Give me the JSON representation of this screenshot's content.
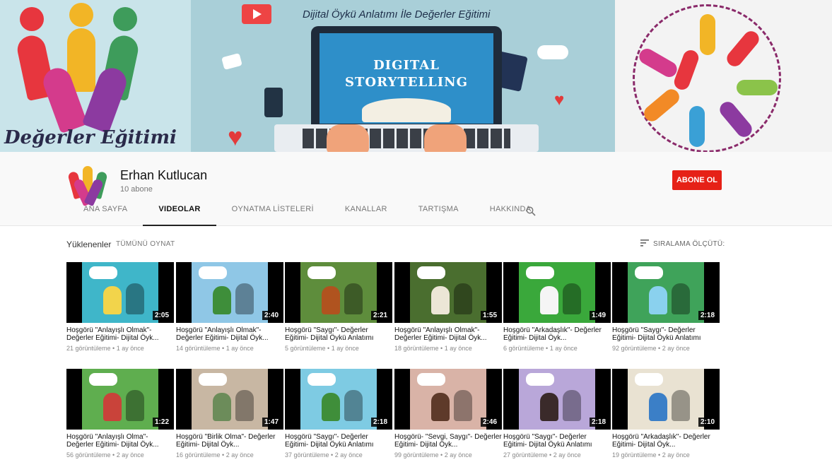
{
  "banner": {
    "title": "Dijital Öykü Anlatımı İle Değerler Eğitimi",
    "screen_line1": "DIGITAL",
    "screen_line2": "STORYTELLING",
    "left_word": "Değerler Eğitimi"
  },
  "channel": {
    "name": "Erhan Kutlucan",
    "subscribers": "10 abone",
    "subscribe_label": "ABONE OL"
  },
  "tabs": [
    "ANA SAYFA",
    "VIDEOLAR",
    "OYNATMA LİSTELERİ",
    "KANALLAR",
    "TARTIŞMA",
    "HAKKINDA"
  ],
  "uploads": {
    "title": "Yüklenenler",
    "play_all": "TÜMÜNÜ OYNAT",
    "sort_label": "SIRALAMA ÖLÇÜTÜ:"
  },
  "videos": [
    {
      "title": "Hoşgörü \"Anlayışlı Olmak\"- Değerler Eğitimi- Dijital Öyk...",
      "meta": "21 görüntüleme • 1 ay önce",
      "duration": "2:05",
      "bg": "#3fb6c9",
      "fg": "#f2d44b"
    },
    {
      "title": "Hoşgörü \"Anlayışlı Olmak\"- Değerler Eğitimi- Dijital Öyk...",
      "meta": "14 görüntüleme • 1 ay önce",
      "duration": "2:40",
      "bg": "#8fc7e6",
      "fg": "#3e8e3a"
    },
    {
      "title": "Hoşgörü \"Saygı\"- Değerler Eğitimi- Dijital Öykü Anlatımı",
      "meta": "5 görüntüleme • 1 ay önce",
      "duration": "2:21",
      "bg": "#5e8d3c",
      "fg": "#b0531f"
    },
    {
      "title": "Hoşgörü \"Anlayışlı Olmak\"- Değerler Eğitimi- Dijital Öyk...",
      "meta": "18 görüntüleme • 1 ay önce",
      "duration": "1:55",
      "bg": "#4a6e2f",
      "fg": "#ece6d6"
    },
    {
      "title": "Hoşgörü \"Arkadaşlık\"- Değerler Eğitimi- Dijital Öyk...",
      "meta": "6 görüntüleme • 1 ay önce",
      "duration": "1:49",
      "bg": "#3aa83b",
      "fg": "#f5f5f5"
    },
    {
      "title": "Hoşgörü \"Saygı\"- Değerler Eğitimi- Dijital Öykü Anlatımı",
      "meta": "92 görüntüleme • 2 ay önce",
      "duration": "2:18",
      "bg": "#3fa35a",
      "fg": "#8ad1ee"
    },
    {
      "title": "Hoşgörü \"Anlayışlı Olma\"- Değerler Eğitimi- Dijital Öyk...",
      "meta": "56 görüntüleme • 2 ay önce",
      "duration": "1:22",
      "bg": "#5fae4f",
      "fg": "#c9433a"
    },
    {
      "title": "Hoşgörü \"Birlik Olma\"- Değerler Eğitimi- Dijital Öyk...",
      "meta": "16 görüntüleme • 2 ay önce",
      "duration": "1:47",
      "bg": "#c8b7a3",
      "fg": "#6c8c5a"
    },
    {
      "title": "Hoşgörü \"Saygı\"- Değerler Eğitimi- Dijital Öykü Anlatımı",
      "meta": "37 görüntüleme • 2 ay önce",
      "duration": "2:18",
      "bg": "#7ecbe3",
      "fg": "#3f8e3a"
    },
    {
      "title": "Hoşgörü- \"Sevgi, Saygı\"- Değerler Eğitimi- Dijital Öyk...",
      "meta": "99 görüntüleme • 2 ay önce",
      "duration": "2:46",
      "bg": "#d9b3a7",
      "fg": "#5e3a2a"
    },
    {
      "title": "Hoşgörü \"Saygı\"- Değerler Eğitimi- Dijital Öykü Anlatımı",
      "meta": "27 görüntüleme • 2 ay önce",
      "duration": "2:18",
      "bg": "#b9a7d9",
      "fg": "#3a2a2a"
    },
    {
      "title": "Hoşgörü \"Arkadaşlık\"- Değerler Eğitimi- Dijital Öyk...",
      "meta": "19 görüntüleme • 2 ay önce",
      "duration": "2:10",
      "bg": "#e9e2d2",
      "fg": "#3b7fc7"
    }
  ],
  "colors": {
    "subscribe": "#e62117",
    "active_tab_underline": "#222222"
  },
  "icons": {
    "search": "search-icon",
    "sort": "sort-icon"
  }
}
